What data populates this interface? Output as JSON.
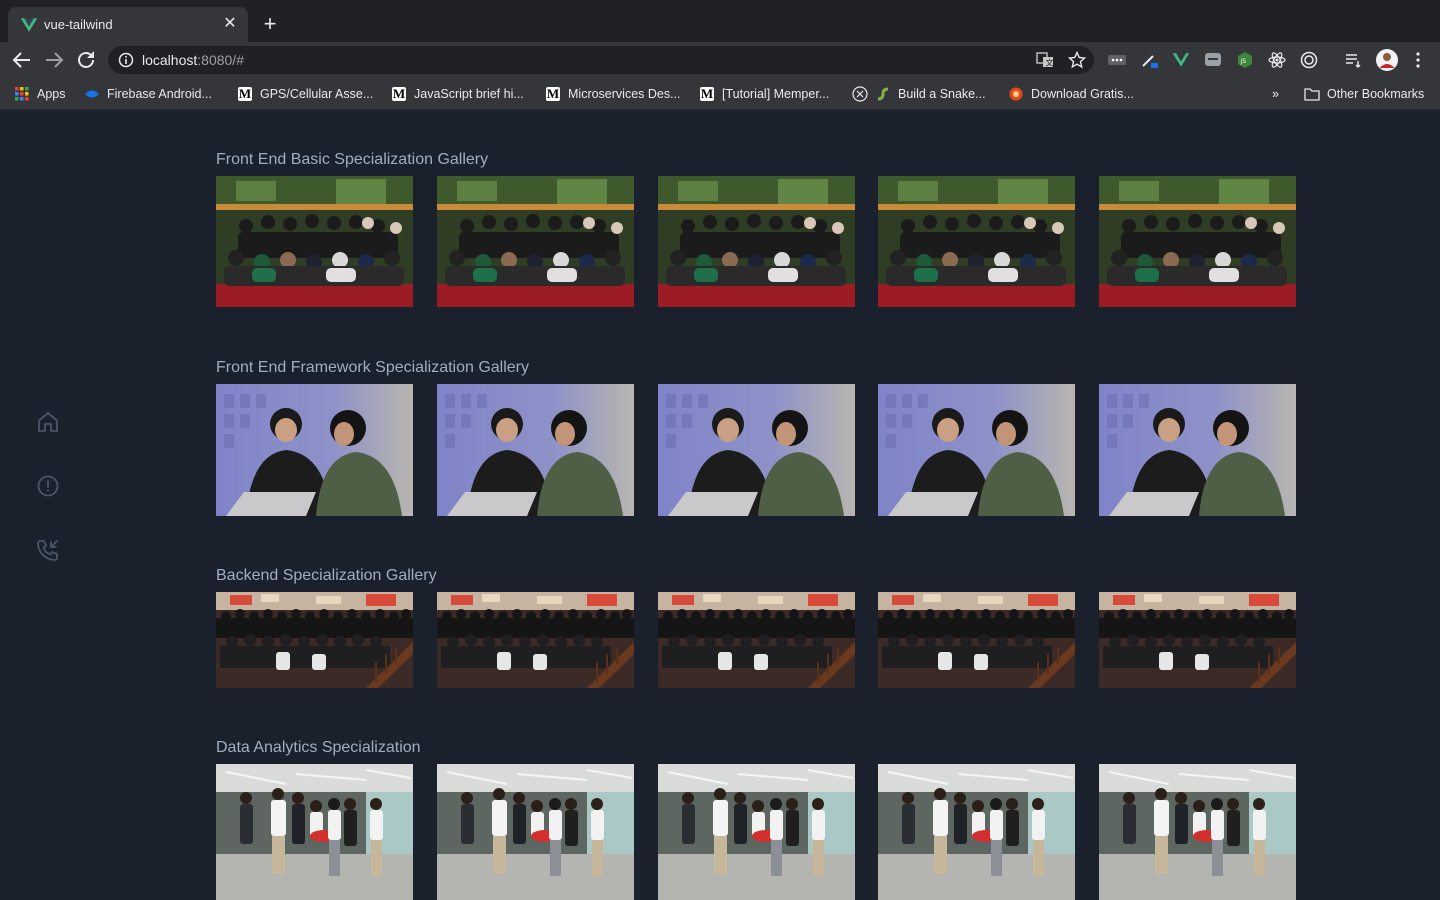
{
  "browser": {
    "tab": {
      "title": "vue-tailwind",
      "favicon": "vue-icon"
    },
    "url": {
      "host": "localhost",
      "rest": ":8080/#"
    },
    "bookmarks": [
      {
        "label": "Apps",
        "icon": "apps-grid-icon"
      },
      {
        "label": "Firebase Android...",
        "icon": "firebase-icon"
      },
      {
        "label": "GPS/Cellular Asse...",
        "icon": "medium-icon"
      },
      {
        "label": "JavaScript brief hi...",
        "icon": "medium-icon"
      },
      {
        "label": "Microservices Des...",
        "icon": "medium-icon"
      },
      {
        "label": "[Tutorial] Memper...",
        "icon": "medium-icon"
      },
      {
        "label": "Build a Snake...",
        "icon": "snake-icon"
      },
      {
        "label": "Download Gratis...",
        "icon": "download-icon"
      }
    ],
    "other_bookmarks": "Other Bookmarks",
    "overflow": "»"
  },
  "sidebar": {
    "items": [
      {
        "name": "home",
        "icon": "home-icon"
      },
      {
        "name": "about",
        "icon": "alert-circle-icon"
      },
      {
        "name": "contact",
        "icon": "phone-incoming-icon"
      }
    ]
  },
  "galleries": [
    {
      "title": "Front End Basic Specialization Gallery",
      "photo": "group-photo-outdoor"
    },
    {
      "title": "Front End Framework Specialization Gallery",
      "photo": "two-people-laptop"
    },
    {
      "title": "Backend Specialization Gallery",
      "photo": "large-group-photo"
    },
    {
      "title": "Data Analytics Specialization",
      "photo": "standing-group-photo"
    }
  ],
  "colors": {
    "page_bg": "#1a202c",
    "title": "#a0aec0",
    "chrome_dark": "#202124",
    "chrome_light": "#35363a"
  }
}
